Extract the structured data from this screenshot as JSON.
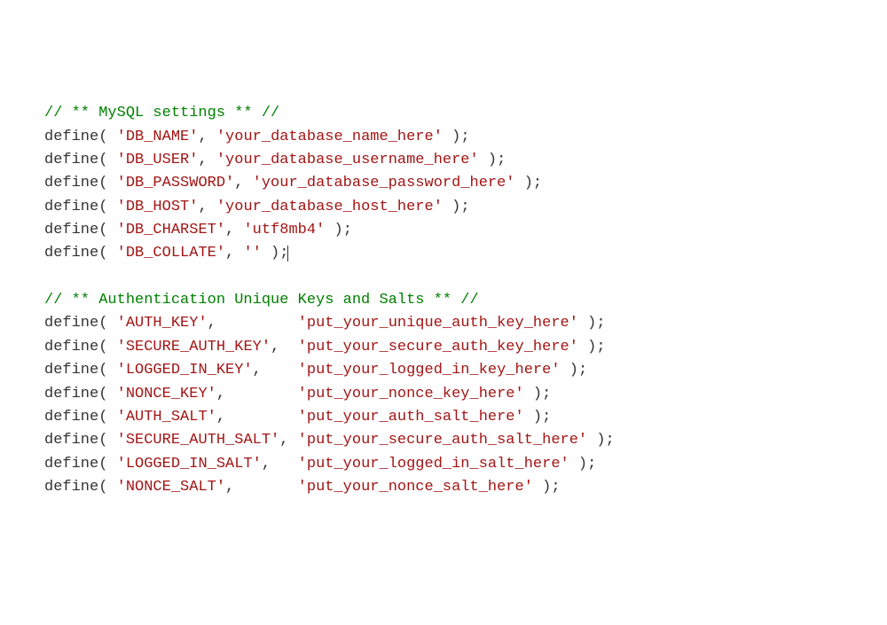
{
  "comments": {
    "mysql": "// ** MySQL settings ** //",
    "auth": "// ** Authentication Unique Keys and Salts ** //"
  },
  "defineKeyword": "define",
  "mysqlSettings": [
    {
      "key": "'DB_NAME'",
      "value": "'your_database_name_here'",
      "padding": ""
    },
    {
      "key": "'DB_USER'",
      "value": "'your_database_username_here'",
      "padding": ""
    },
    {
      "key": "'DB_PASSWORD'",
      "value": "'your_database_password_here'",
      "padding": ""
    },
    {
      "key": "'DB_HOST'",
      "value": "'your_database_host_here'",
      "padding": ""
    },
    {
      "key": "'DB_CHARSET'",
      "value": "'utf8mb4'",
      "padding": ""
    },
    {
      "key": "'DB_COLLATE'",
      "value": "''",
      "padding": ""
    }
  ],
  "authSettings": [
    {
      "key": "'AUTH_KEY'",
      "value": "'put_your_unique_auth_key_here'",
      "padding": "        "
    },
    {
      "key": "'SECURE_AUTH_KEY'",
      "value": "'put_your_secure_auth_key_here'",
      "padding": " "
    },
    {
      "key": "'LOGGED_IN_KEY'",
      "value": "'put_your_logged_in_key_here'",
      "padding": "   "
    },
    {
      "key": "'NONCE_KEY'",
      "value": "'put_your_nonce_key_here'",
      "padding": "       "
    },
    {
      "key": "'AUTH_SALT'",
      "value": "'put_your_auth_salt_here'",
      "padding": "       "
    },
    {
      "key": "'SECURE_AUTH_SALT'",
      "value": "'put_your_secure_auth_salt_here'",
      "padding": ""
    },
    {
      "key": "'LOGGED_IN_SALT'",
      "value": "'put_your_logged_in_salt_here'",
      "padding": "  "
    },
    {
      "key": "'NONCE_SALT'",
      "value": "'put_your_nonce_salt_here'",
      "padding": "      "
    }
  ]
}
